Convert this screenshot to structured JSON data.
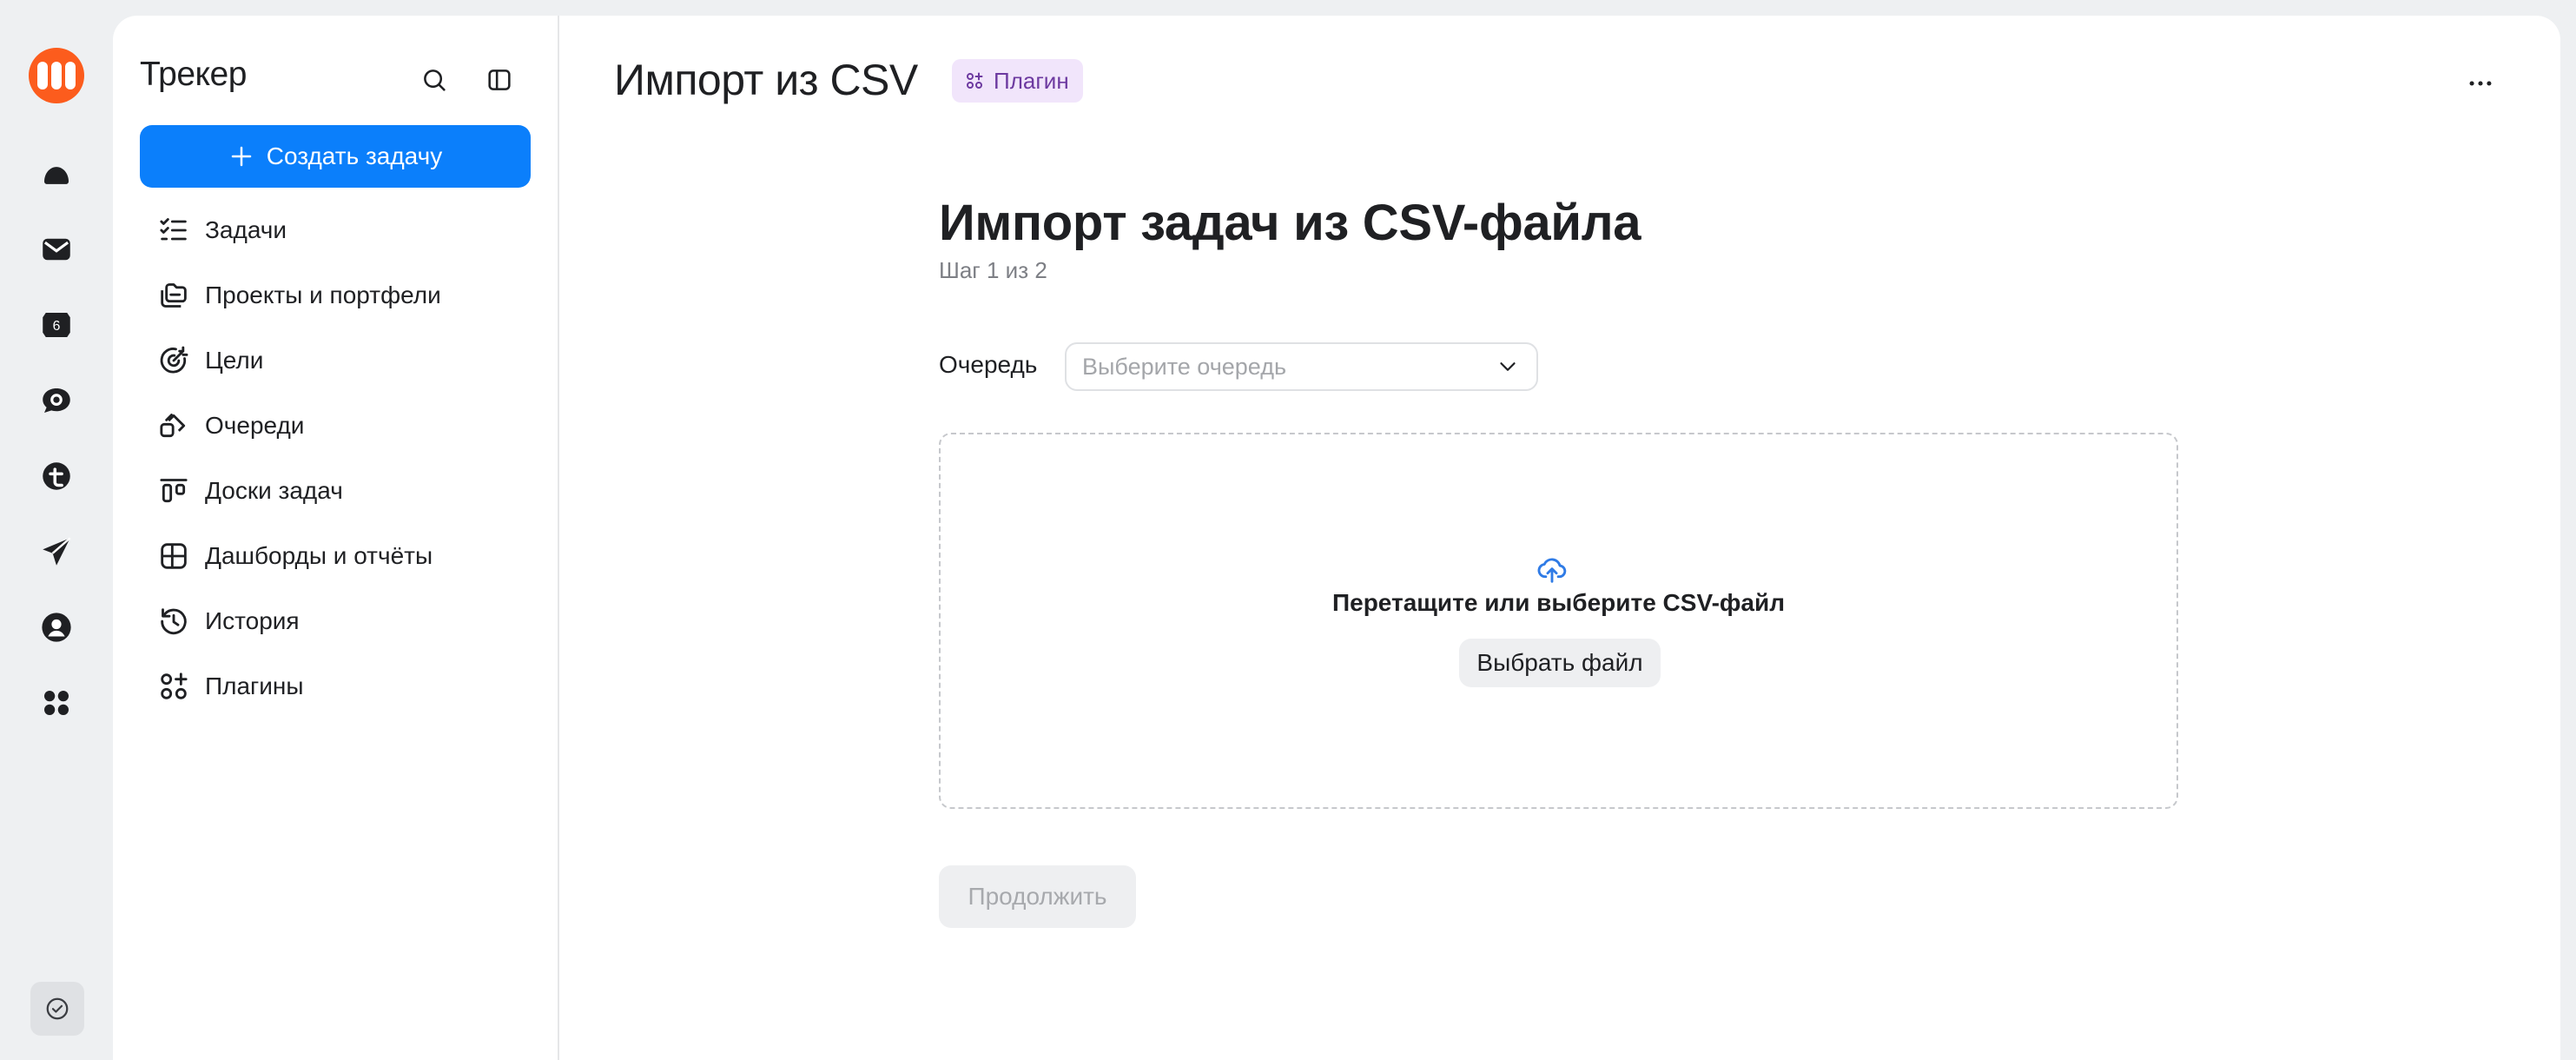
{
  "rail": {
    "items": [
      {
        "name": "cloud-icon"
      },
      {
        "name": "mail-icon"
      },
      {
        "name": "calendar-icon",
        "badge": "6"
      },
      {
        "name": "messenger-icon"
      },
      {
        "name": "telemost-icon"
      },
      {
        "name": "send-icon"
      },
      {
        "name": "profile-icon"
      },
      {
        "name": "services-grid-icon"
      }
    ],
    "bottom_icon": "check-circle-icon"
  },
  "sidebar": {
    "title": "Трекер",
    "create_label": "Создать задачу",
    "items": [
      {
        "label": "Задачи",
        "icon": "tasks-icon"
      },
      {
        "label": "Проекты и портфели",
        "icon": "projects-icon"
      },
      {
        "label": "Цели",
        "icon": "goals-icon"
      },
      {
        "label": "Очереди",
        "icon": "queues-icon"
      },
      {
        "label": "Доски задач",
        "icon": "boards-icon"
      },
      {
        "label": "Дашборды и отчёты",
        "icon": "dashboards-icon"
      },
      {
        "label": "История",
        "icon": "history-icon"
      },
      {
        "label": "Плагины",
        "icon": "plugins-icon"
      }
    ]
  },
  "header": {
    "title": "Импорт из CSV",
    "badge": "Плагин"
  },
  "main": {
    "title": "Импорт задач из CSV-файла",
    "step": "Шаг 1 из 2",
    "queue_label": "Очередь",
    "queue_placeholder": "Выберите очередь",
    "dropzone_text": "Перетащите или выберите CSV-файл",
    "choose_file": "Выбрать файл",
    "continue": "Продолжить"
  },
  "colors": {
    "accent": "#0b7ffb",
    "logo": "#fc5c1d",
    "badge_bg": "#f1e5fb",
    "badge_text": "#6d3aa0"
  }
}
